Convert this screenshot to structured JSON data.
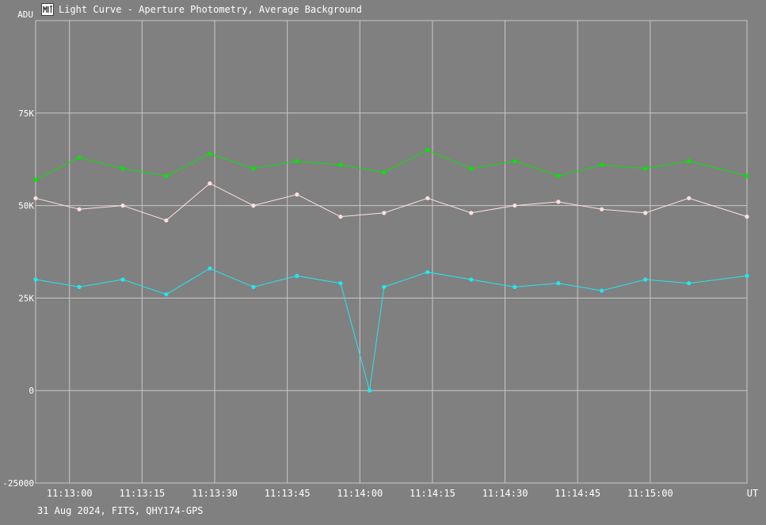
{
  "window": {
    "title": "Light Curve - Aperture Photometry, Average Background",
    "icon": "app-icon"
  },
  "footer": {
    "text": "31 Aug 2024, FITS, QHY174-GPS"
  },
  "colors": {
    "background": "#808080",
    "grid": "#c8c8c8",
    "series_green": "#00e600",
    "series_pink": "#ffe0e0",
    "series_cyan": "#20e8f0"
  },
  "chart_data": {
    "type": "line",
    "ylabel": "ADU",
    "xlabel": "UT",
    "ylim": [
      -25000,
      100000
    ],
    "xlim": [
      "11:12:53",
      "11:15:20"
    ],
    "y_ticks": [
      {
        "value": 75000,
        "label": "75K"
      },
      {
        "value": 50000,
        "label": "50K"
      },
      {
        "value": 25000,
        "label": "25K"
      },
      {
        "value": 0,
        "label": "0"
      },
      {
        "value": -25000,
        "label": "-25000"
      }
    ],
    "x_ticks": [
      "11:13:00",
      "11:13:15",
      "11:13:30",
      "11:13:45",
      "11:14:00",
      "11:14:15",
      "11:14:30",
      "11:14:45",
      "11:15:00"
    ],
    "grid": true,
    "series": [
      {
        "color": "#00e600",
        "x": [
          "11:12:53",
          "11:13:02",
          "11:13:11",
          "11:13:20",
          "11:13:29",
          "11:13:38",
          "11:13:47",
          "11:13:56",
          "11:14:05",
          "11:14:14",
          "11:14:23",
          "11:14:32",
          "11:14:41",
          "11:14:50",
          "11:14:59",
          "11:15:08",
          "11:15:20"
        ],
        "y": [
          57000,
          63000,
          60000,
          58000,
          64000,
          60000,
          62000,
          61000,
          59000,
          65000,
          60000,
          62000,
          58000,
          61000,
          60000,
          62000,
          58000
        ]
      },
      {
        "color": "#ffe0e0",
        "x": [
          "11:12:53",
          "11:13:02",
          "11:13:11",
          "11:13:20",
          "11:13:29",
          "11:13:38",
          "11:13:47",
          "11:13:56",
          "11:14:05",
          "11:14:14",
          "11:14:23",
          "11:14:32",
          "11:14:41",
          "11:14:50",
          "11:14:59",
          "11:15:08",
          "11:15:20"
        ],
        "y": [
          52000,
          49000,
          50000,
          46000,
          56000,
          50000,
          53000,
          47000,
          48000,
          52000,
          48000,
          50000,
          51000,
          49000,
          48000,
          52000,
          47000
        ]
      },
      {
        "color": "#20e8f0",
        "x": [
          "11:12:53",
          "11:13:02",
          "11:13:11",
          "11:13:20",
          "11:13:29",
          "11:13:38",
          "11:13:47",
          "11:13:56",
          "11:14:02",
          "11:14:05",
          "11:14:14",
          "11:14:23",
          "11:14:32",
          "11:14:41",
          "11:14:50",
          "11:14:59",
          "11:15:08",
          "11:15:20"
        ],
        "y": [
          30000,
          28000,
          30000,
          26000,
          33000,
          28000,
          31000,
          29000,
          0,
          28000,
          32000,
          30000,
          28000,
          29000,
          27000,
          30000,
          29000,
          31000
        ]
      }
    ]
  }
}
